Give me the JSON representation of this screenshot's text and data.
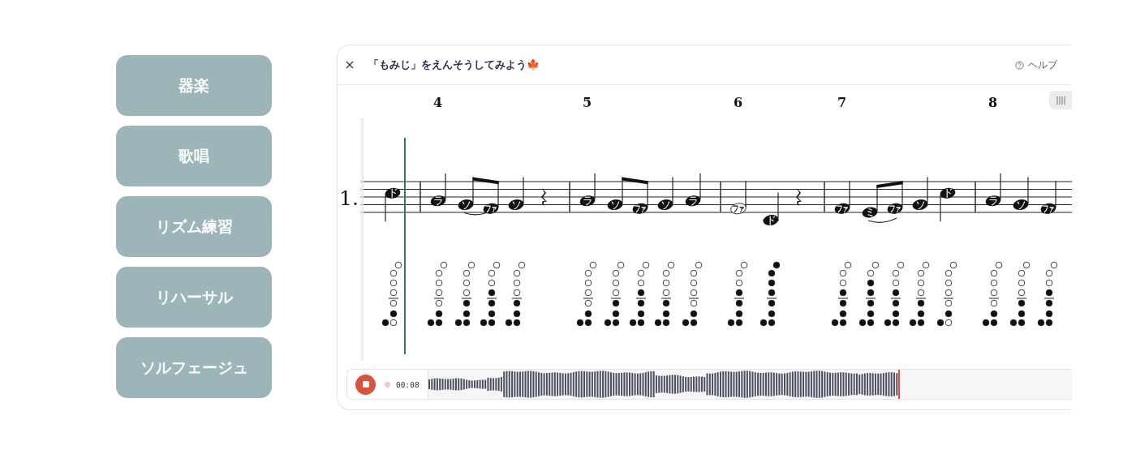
{
  "modes": [
    {
      "label": "器楽"
    },
    {
      "label": "歌唱"
    },
    {
      "label": "リズム練習"
    },
    {
      "label": "リハーサル"
    },
    {
      "label": "ソルフェージュ"
    }
  ],
  "header": {
    "title": "「もみじ」をえんそうしてみよう🍁",
    "help": "ヘルプ"
  },
  "score": {
    "part_label": "1.",
    "measures": [
      {
        "notes": [
          {
            "kind": "quarter-c5",
            "syllable": "ド",
            "holes": [
              true,
              false,
              true,
              false,
              false,
              false,
              false,
              false
            ]
          }
        ]
      },
      {
        "number": "4",
        "notes": [
          {
            "kind": "quarter-a4",
            "syllable": "ラ",
            "holes": [
              true,
              true,
              true,
              false,
              false,
              false,
              false,
              false
            ]
          },
          {
            "kind": "eighth-g4",
            "syllable": "ソ",
            "slur": true,
            "holes": [
              true,
              true,
              true,
              true,
              false,
              false,
              false,
              false
            ]
          },
          {
            "kind": "eighth-f4",
            "syllable": "ファ",
            "holes": [
              true,
              true,
              true,
              true,
              true,
              false,
              false,
              false
            ]
          },
          {
            "kind": "quarter-g4",
            "syllable": "ソ",
            "holes": [
              true,
              true,
              true,
              true,
              false,
              false,
              false,
              false
            ]
          },
          {
            "kind": "rest"
          }
        ]
      },
      {
        "number": "5",
        "notes": [
          {
            "kind": "quarter-a4",
            "syllable": "ラ",
            "holes": [
              true,
              true,
              true,
              false,
              false,
              false,
              false,
              false
            ]
          },
          {
            "kind": "eighth-g4",
            "syllable": "ソ",
            "holes": [
              true,
              true,
              true,
              true,
              false,
              false,
              false,
              false
            ]
          },
          {
            "kind": "eighth-f4",
            "syllable": "ファ",
            "holes": [
              true,
              true,
              true,
              true,
              true,
              false,
              false,
              false
            ]
          },
          {
            "kind": "quarter-g4",
            "syllable": "ソ",
            "holes": [
              true,
              true,
              true,
              true,
              false,
              false,
              false,
              false
            ]
          },
          {
            "kind": "quarter-a4",
            "syllable": "ラ",
            "holes": [
              true,
              true,
              true,
              false,
              false,
              false,
              false,
              false
            ]
          }
        ]
      },
      {
        "number": "6",
        "notes": [
          {
            "kind": "half-f4",
            "syllable": "ファ",
            "holes": [
              true,
              true,
              true,
              true,
              true,
              false,
              false,
              false
            ]
          },
          {
            "kind": "quarter-c4",
            "syllable": "ド",
            "holes": [
              true,
              true,
              true,
              true,
              true,
              true,
              true,
              true
            ]
          },
          {
            "kind": "rest"
          }
        ]
      },
      {
        "number": "7",
        "notes": [
          {
            "kind": "quarter-f4",
            "syllable": "ファ",
            "holes": [
              true,
              true,
              true,
              true,
              true,
              false,
              false,
              false
            ]
          },
          {
            "kind": "eighth-e4",
            "syllable": "ミ",
            "slur": true,
            "holes": [
              true,
              true,
              true,
              true,
              true,
              true,
              false,
              false
            ]
          },
          {
            "kind": "eighth-f4",
            "syllable": "ファ",
            "holes": [
              true,
              true,
              true,
              true,
              true,
              false,
              false,
              false
            ]
          },
          {
            "kind": "quarter-g4",
            "syllable": "ソ",
            "holes": [
              true,
              true,
              true,
              true,
              false,
              false,
              false,
              false
            ]
          },
          {
            "kind": "quarter-c5",
            "syllable": "ド",
            "holes": [
              true,
              false,
              true,
              false,
              false,
              false,
              false,
              false
            ]
          }
        ]
      },
      {
        "number": "8",
        "notes": [
          {
            "kind": "quarter-a4",
            "syllable": "ラ",
            "holes": [
              true,
              true,
              true,
              false,
              false,
              false,
              false,
              false
            ]
          },
          {
            "kind": "quarter-g4",
            "syllable": "ソ",
            "holes": [
              true,
              true,
              true,
              true,
              false,
              false,
              false,
              false
            ]
          },
          {
            "kind": "quarter-f4",
            "syllable": "ファ",
            "holes": [
              true,
              true,
              true,
              true,
              true,
              false,
              false,
              false
            ]
          }
        ]
      }
    ]
  },
  "player": {
    "recording": true,
    "time": "00:08",
    "level": 0.73
  }
}
